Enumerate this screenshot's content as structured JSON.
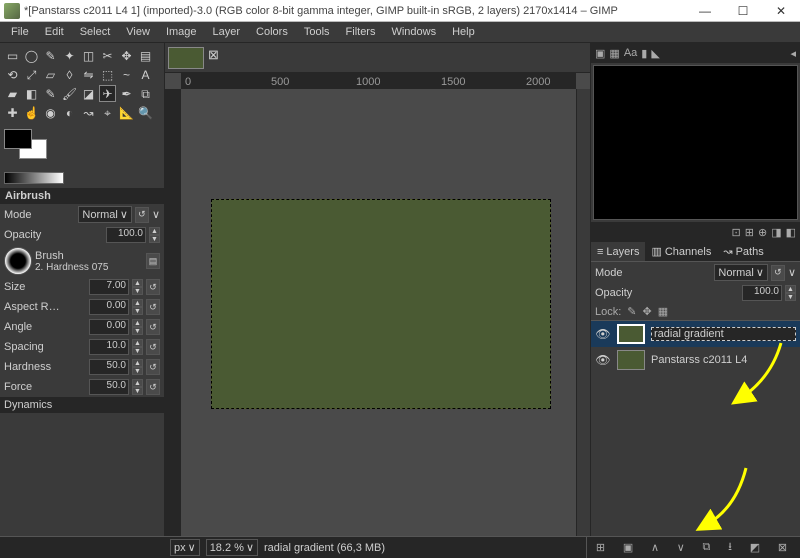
{
  "window": {
    "title": "*[Panstarss c2011 L4 1] (imported)-3.0 (RGB color 8-bit gamma integer, GIMP built-in sRGB, 2 layers) 2170x1414 – GIMP",
    "minimize": "—",
    "maximize": "☐",
    "close": "✕"
  },
  "menu": {
    "file": "File",
    "edit": "Edit",
    "select": "Select",
    "view": "View",
    "image": "Image",
    "layer": "Layer",
    "colors": "Colors",
    "tools": "Tools",
    "filters": "Filters",
    "windows": "Windows",
    "help": "Help"
  },
  "tool_options": {
    "panel": "Airbrush",
    "mode_label": "Mode",
    "mode_value": "Normal",
    "opacity_label": "Opacity",
    "opacity_value": "100.0",
    "brush_label": "Brush",
    "brush_name": "2. Hardness 075",
    "size_label": "Size",
    "size_value": "7.00",
    "aspect_label": "Aspect R…",
    "aspect_value": "0.00",
    "angle_label": "Angle",
    "angle_value": "0.00",
    "spacing_label": "Spacing",
    "spacing_value": "10.0",
    "hardness_label": "Hardness",
    "hardness_value": "50.0",
    "force_label": "Force",
    "force_value": "50.0",
    "dynamics_label": "Dynamics"
  },
  "ruler": {
    "t1": "0",
    "t2": "500",
    "t3": "1000",
    "t4": "1500",
    "t5": "2000"
  },
  "status": {
    "unit": "px",
    "zoom": "18.2 %",
    "layer": "radial gradient (66,3 MB)"
  },
  "right": {
    "tabs": {
      "layers": "Layers",
      "channels": "Channels",
      "paths": "Paths"
    },
    "mode_label": "Mode",
    "mode_value": "Normal",
    "opacity_label": "Opacity",
    "opacity_value": "100.0",
    "lock_label": "Lock:",
    "layer1": "radial gradient",
    "layer2": "Panstarss c2011 L4"
  }
}
